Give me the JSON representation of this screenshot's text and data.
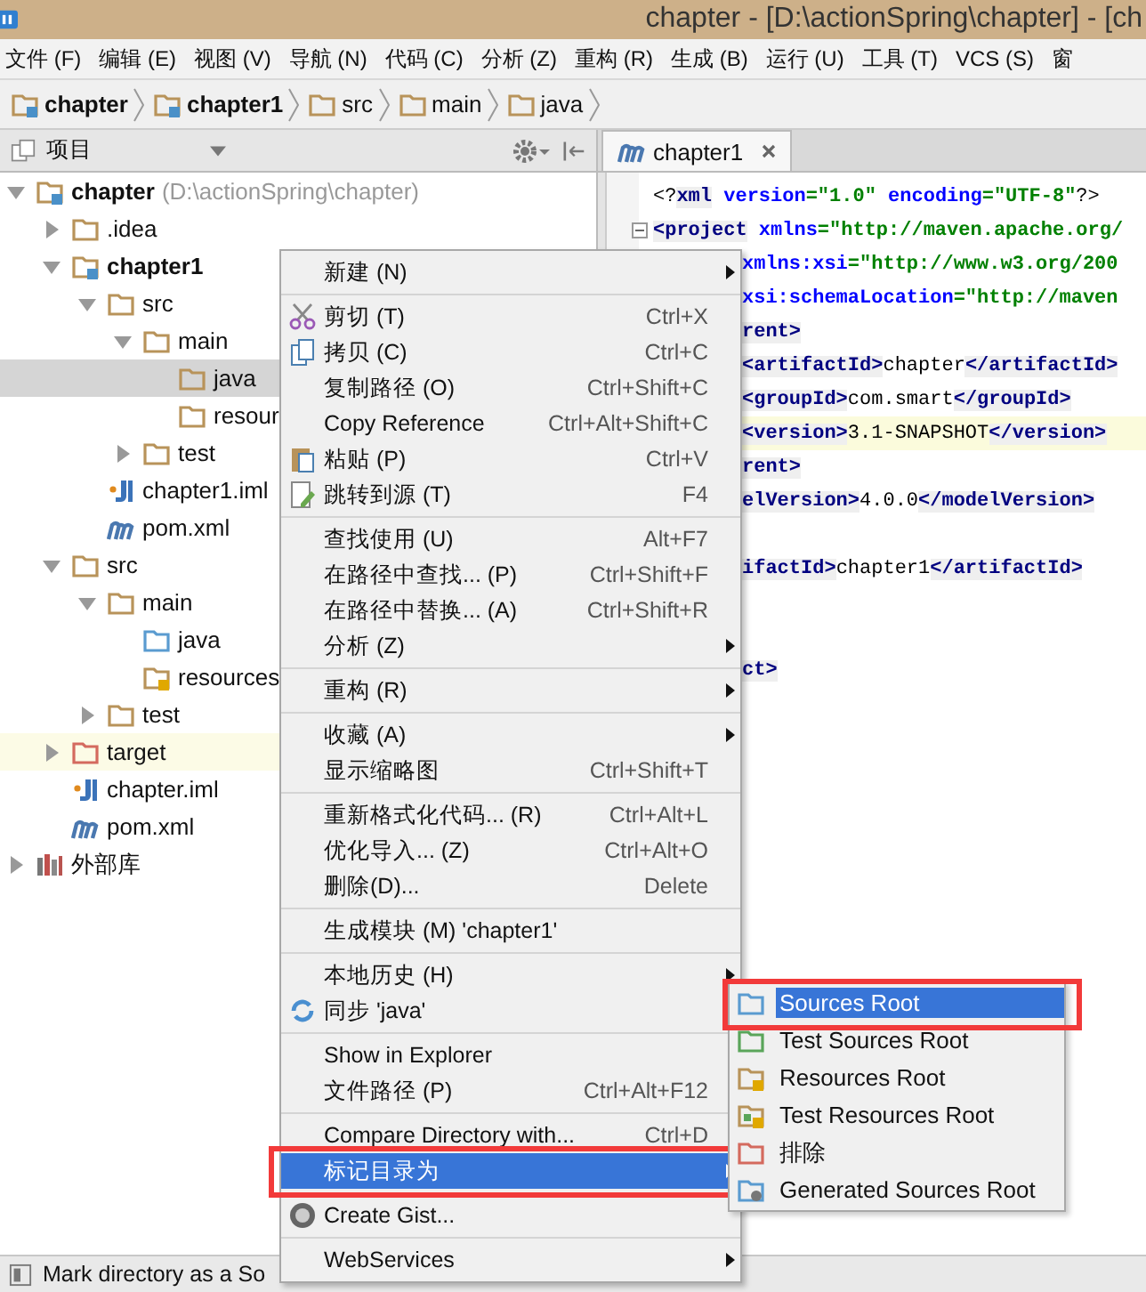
{
  "window": {
    "title": "chapter - [D:\\actionSpring\\chapter] - [ch"
  },
  "menu_bar": [
    "文件 (F)",
    "编辑 (E)",
    "视图 (V)",
    "导航 (N)",
    "代码 (C)",
    "分析 (Z)",
    "重构 (R)",
    "生成 (B)",
    "运行 (U)",
    "工具 (T)",
    "VCS (S)",
    "窗"
  ],
  "breadcrumbs": [
    {
      "label": "chapter",
      "kind": "module"
    },
    {
      "label": "chapter1",
      "kind": "module"
    },
    {
      "label": "src",
      "kind": "folder"
    },
    {
      "label": "main",
      "kind": "folder"
    },
    {
      "label": "java",
      "kind": "folder"
    }
  ],
  "project_panel": {
    "title": "项目"
  },
  "editor_tabs": [
    {
      "label": "chapter1",
      "selected": true
    }
  ],
  "project_tree": [
    {
      "label": "chapter",
      "note": "(D:\\actionSpring\\chapter)",
      "kind": "module",
      "expanded": true,
      "selected": false,
      "children": [
        {
          "label": ".idea",
          "kind": "folder",
          "expanded": false,
          "selected": false
        },
        {
          "label": "chapter1",
          "kind": "module",
          "expanded": true,
          "selected": false,
          "children": [
            {
              "label": "src",
              "kind": "folder",
              "expanded": true,
              "selected": false,
              "children": [
                {
                  "label": "main",
                  "kind": "folder",
                  "expanded": true,
                  "selected": false,
                  "children": [
                    {
                      "label": "java",
                      "kind": "folder",
                      "selected": true
                    },
                    {
                      "label": "resour",
                      "kind": "folder",
                      "selected": false
                    }
                  ]
                },
                {
                  "label": "test",
                  "kind": "folder",
                  "expanded": false,
                  "selected": false
                }
              ]
            },
            {
              "label": "chapter1.iml",
              "kind": "iml",
              "selected": false
            },
            {
              "label": "pom.xml",
              "kind": "pom",
              "selected": false
            }
          ]
        },
        {
          "label": "src",
          "kind": "folder",
          "expanded": true,
          "selected": false,
          "children": [
            {
              "label": "main",
              "kind": "folder",
              "expanded": true,
              "selected": false,
              "children": [
                {
                  "label": "java",
                  "kind": "source",
                  "selected": false
                },
                {
                  "label": "resources",
                  "kind": "resource",
                  "selected": false
                }
              ]
            },
            {
              "label": "test",
              "kind": "folder",
              "expanded": false,
              "selected": false
            }
          ]
        },
        {
          "label": "target",
          "kind": "excluded",
          "expanded": false,
          "selected": false
        },
        {
          "label": "chapter.iml",
          "kind": "iml",
          "selected": false
        },
        {
          "label": "pom.xml",
          "kind": "pom",
          "selected": false
        }
      ]
    },
    {
      "label": "外部库",
      "kind": "library",
      "expanded": false,
      "selected": false
    }
  ],
  "editor": {
    "lines": [
      {
        "segments": [
          {
            "text": "<?",
            "kind": "text"
          },
          {
            "text": "xml",
            "kind": "tag"
          },
          {
            "text": " version",
            "kind": "attr"
          },
          {
            "text": "=\"1.0\"",
            "kind": "value"
          },
          {
            "text": " encoding",
            "kind": "attr"
          },
          {
            "text": "=\"UTF-8\"",
            "kind": "value"
          },
          {
            "text": "?>",
            "kind": "text"
          }
        ]
      },
      {
        "fold": true,
        "segments": [
          {
            "text": "<project",
            "kind": "tag"
          },
          {
            "text": " xmlns",
            "kind": "attr"
          },
          {
            "text": "=\"http://maven.apache.org/",
            "kind": "value"
          }
        ]
      },
      {
        "segments": [
          {
            "text": "xmlns:xsi",
            "kind": "attr"
          },
          {
            "text": "=\"http://www.w3.org/200",
            "kind": "value"
          }
        ]
      },
      {
        "segments": [
          {
            "text": "xsi:schemaLocation",
            "kind": "attr"
          },
          {
            "text": "=\"http://maven",
            "kind": "value"
          }
        ]
      },
      {
        "segments": [
          {
            "text": "rent>",
            "kind": "tag"
          }
        ]
      },
      {
        "segments": [
          {
            "text": "<artifactId>",
            "kind": "tag"
          },
          {
            "text": "chapter",
            "kind": "text"
          },
          {
            "text": "</artifactId>",
            "kind": "tag"
          }
        ]
      },
      {
        "segments": [
          {
            "text": "<groupId>",
            "kind": "tag"
          },
          {
            "text": "com.smart",
            "kind": "text"
          },
          {
            "text": "</groupId>",
            "kind": "tag"
          }
        ]
      },
      {
        "current": true,
        "segments": [
          {
            "text": "<version>",
            "kind": "tag"
          },
          {
            "text": "3.1-SNAPSHOT",
            "kind": "text"
          },
          {
            "text": "</version>",
            "kind": "tag"
          }
        ]
      },
      {
        "segments": [
          {
            "text": "rent>",
            "kind": "tag"
          }
        ]
      },
      {
        "segments": [
          {
            "text": "elVersion>",
            "kind": "tag"
          },
          {
            "text": "4.0.0",
            "kind": "text"
          },
          {
            "text": "</modelVersion>",
            "kind": "tag"
          }
        ]
      },
      {
        "segments": [
          {
            "text": "ifactId>",
            "kind": "tag"
          },
          {
            "text": "chapter1",
            "kind": "text"
          },
          {
            "text": "</artifactId>",
            "kind": "tag"
          }
        ]
      },
      {
        "segments": [
          {
            "text": "ct>",
            "kind": "tag"
          }
        ]
      }
    ]
  },
  "context_menu": {
    "groups": [
      [
        {
          "label": "新建 (N)",
          "submenu": true,
          "selected": false
        }
      ],
      [
        {
          "label": "剪切 (T)",
          "shortcut": "Ctrl+X",
          "selected": false
        },
        {
          "label": "拷贝 (C)",
          "shortcut": "Ctrl+C",
          "selected": false
        },
        {
          "label": "复制路径 (O)",
          "shortcut": "Ctrl+Shift+C",
          "selected": false
        },
        {
          "label": "Copy Reference",
          "shortcut": "Ctrl+Alt+Shift+C",
          "selected": false
        },
        {
          "label": "粘贴 (P)",
          "shortcut": "Ctrl+V",
          "selected": false
        },
        {
          "label": "跳转到源 (T)",
          "shortcut": "F4",
          "selected": false
        }
      ],
      [
        {
          "label": "查找使用 (U)",
          "shortcut": "Alt+F7",
          "selected": false
        },
        {
          "label": "在路径中查找... (P)",
          "shortcut": "Ctrl+Shift+F",
          "selected": false
        },
        {
          "label": "在路径中替换... (A)",
          "shortcut": "Ctrl+Shift+R",
          "selected": false
        },
        {
          "label": "分析 (Z)",
          "submenu": true,
          "selected": false
        }
      ],
      [
        {
          "label": "重构 (R)",
          "submenu": true,
          "selected": false
        }
      ],
      [
        {
          "label": "收藏 (A)",
          "submenu": true,
          "selected": false
        },
        {
          "label": "显示缩略图",
          "shortcut": "Ctrl+Shift+T",
          "selected": false
        }
      ],
      [
        {
          "label": "重新格式化代码... (R)",
          "shortcut": "Ctrl+Alt+L",
          "selected": false
        },
        {
          "label": "优化导入... (Z)",
          "shortcut": "Ctrl+Alt+O",
          "selected": false
        },
        {
          "label": "删除(D)...",
          "shortcut": "Delete",
          "selected": false
        }
      ],
      [
        {
          "label": "生成模块 (M) 'chapter1'",
          "selected": false
        }
      ],
      [
        {
          "label": "本地历史 (H)",
          "submenu": true,
          "selected": false
        },
        {
          "label": "同步 'java'",
          "selected": false
        }
      ],
      [
        {
          "label": "Show in Explorer",
          "selected": false
        },
        {
          "label": "文件路径 (P)",
          "shortcut": "Ctrl+Alt+F12",
          "selected": false
        }
      ],
      [
        {
          "label": "Compare Directory with...",
          "shortcut": "Ctrl+D",
          "selected": false
        },
        {
          "label": "标记目录为",
          "submenu": true,
          "selected": true,
          "highlighted": true
        }
      ],
      [
        {
          "label": "Create Gist...",
          "selected": false
        }
      ],
      [
        {
          "label": "WebServices",
          "submenu": true,
          "selected": false
        }
      ]
    ]
  },
  "submenu": [
    {
      "label": "Sources Root",
      "kind": "source",
      "selected": true,
      "highlighted": true
    },
    {
      "label": "Test Sources Root",
      "kind": "test-source",
      "selected": false
    },
    {
      "label": "Resources Root",
      "kind": "resource",
      "selected": false
    },
    {
      "label": "Test Resources Root",
      "kind": "test-resource",
      "selected": false
    },
    {
      "label": "排除",
      "kind": "excluded",
      "selected": false
    },
    {
      "label": "Generated Sources Root",
      "kind": "generated",
      "selected": false
    }
  ],
  "status_bar": {
    "text": "Mark directory as a So"
  }
}
